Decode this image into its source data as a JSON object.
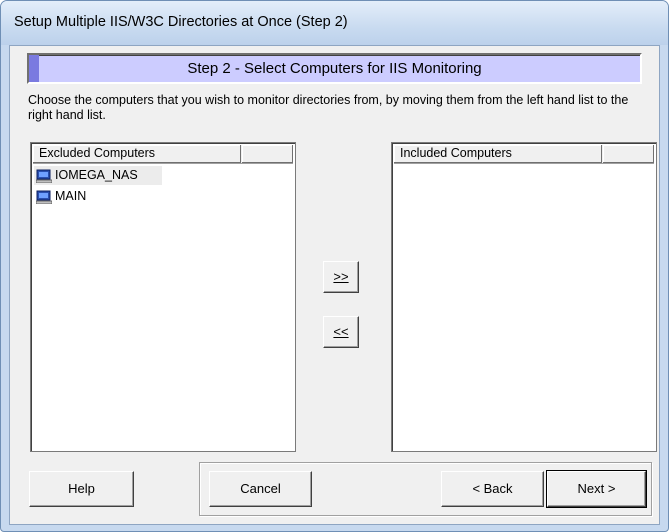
{
  "window": {
    "title": "Setup Multiple IIS/W3C Directories at Once (Step 2)"
  },
  "banner": {
    "text": "Step 2 - Select Computers for IIS Monitoring"
  },
  "instructions": "Choose the computers that you wish to monitor directories from, by moving them from the left hand list to the right hand list.",
  "excluded": {
    "header": "Excluded Computers",
    "items": [
      {
        "label": "IOMEGA_NAS",
        "icon": "computer-icon",
        "selected": true
      },
      {
        "label": "MAIN",
        "icon": "computer-icon",
        "selected": false
      }
    ]
  },
  "included": {
    "header": "Included Computers",
    "items": []
  },
  "move_buttons": {
    "add": ">>",
    "remove": "<<"
  },
  "buttons": {
    "help": "Help",
    "cancel": "Cancel",
    "back": "< Back",
    "next": "Next >"
  },
  "colors": {
    "banner_bg": "#ccccff",
    "banner_accent": "#7a7ae0",
    "title_bar": "#c9dbf0"
  }
}
